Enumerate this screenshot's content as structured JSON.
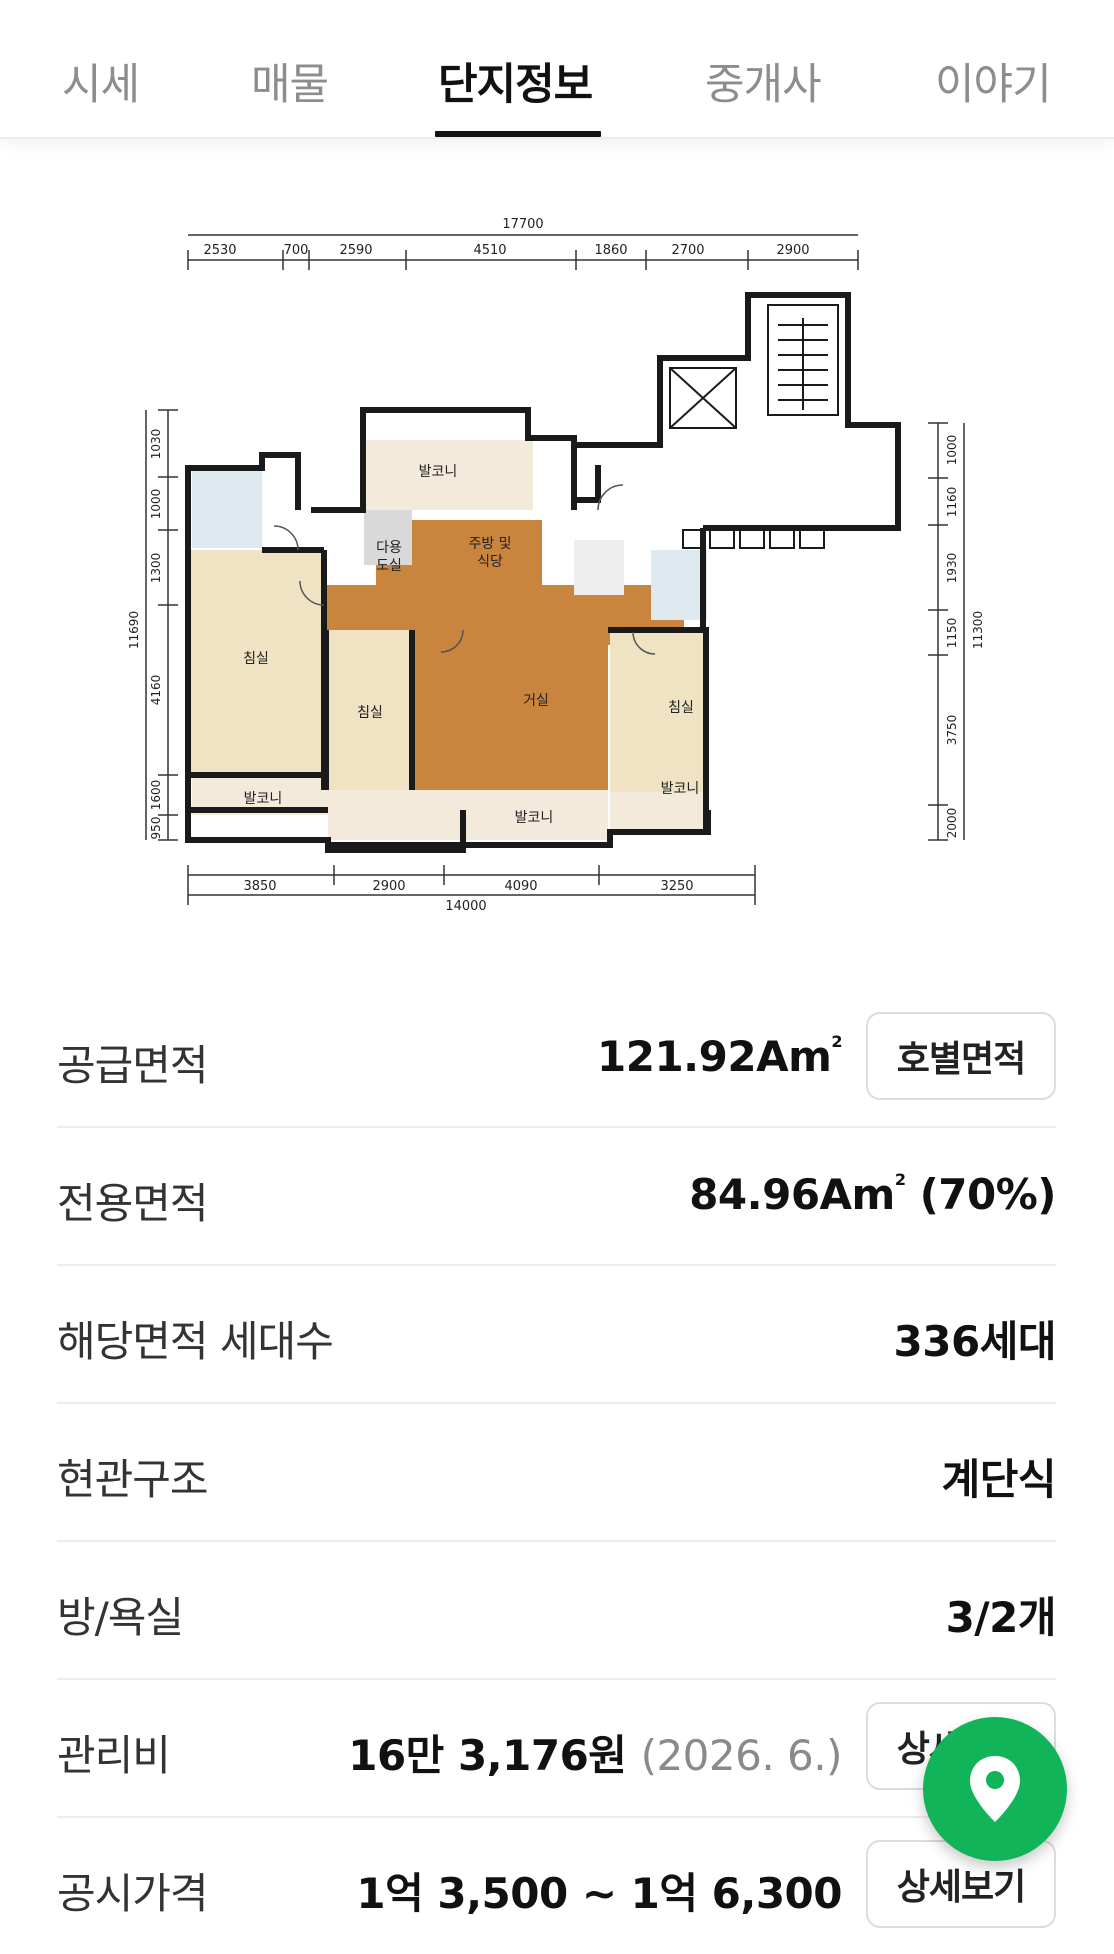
{
  "tabs": [
    {
      "label": "시세"
    },
    {
      "label": "매물"
    },
    {
      "label": "단지정보"
    },
    {
      "label": "중개사"
    },
    {
      "label": "이야기"
    }
  ],
  "active_tab": "단지정보",
  "floorplan": {
    "top_total": "17700",
    "top_dims": [
      "2530",
      "700",
      "2590",
      "4510",
      "1860",
      "2700",
      "2900"
    ],
    "bottom_total": "14000",
    "bottom_dims": [
      "3850",
      "2900",
      "4090",
      "3250"
    ],
    "left_total": "11690",
    "left_dims": [
      "1030",
      "1000",
      "1300",
      "4160",
      "1600",
      "950"
    ],
    "right_total": "11300",
    "right_dims": [
      "1000",
      "1160",
      "1930",
      "1150",
      "3750",
      "2000"
    ],
    "rooms": {
      "balcony_top": "발코니",
      "utility_1": "다용",
      "utility_2": "도실",
      "kitchen_1": "주방 및",
      "kitchen_2": "식당",
      "bedroom_left": "침실",
      "bedroom_mid": "침실",
      "living": "거실",
      "bedroom_right": "침실",
      "balcony_left": "발코니",
      "balcony_bottom": "발코니",
      "balcony_right": "발코니"
    }
  },
  "info": {
    "supply_area": {
      "label": "공급면적",
      "value": "121.92Am",
      "button": "호별면적"
    },
    "exclusive_area": {
      "label": "전용면적",
      "value": "84.96Am",
      "ratio": "(70%)"
    },
    "households": {
      "label": "해당면적 세대수",
      "value": "336세대"
    },
    "entrance": {
      "label": "현관구조",
      "value": "계단식"
    },
    "rooms": {
      "label": "방/욕실",
      "value": "3/2개"
    },
    "fee": {
      "label": "관리비",
      "value": "16만 3,176원",
      "date": "(2026. 6.)",
      "button": "상세보기"
    },
    "price": {
      "label": "공시가격",
      "value": "1억 3,500 ~ 1억 6,300",
      "button": "상세보기"
    }
  },
  "colors": {
    "accent": "#12b45a",
    "floor_wood": "#c9843d",
    "balcony": "#f3eadb",
    "bedroom": "#efe3c4",
    "bath": "#dfeaf0"
  },
  "icons": {
    "fab": "map-pin-icon"
  }
}
